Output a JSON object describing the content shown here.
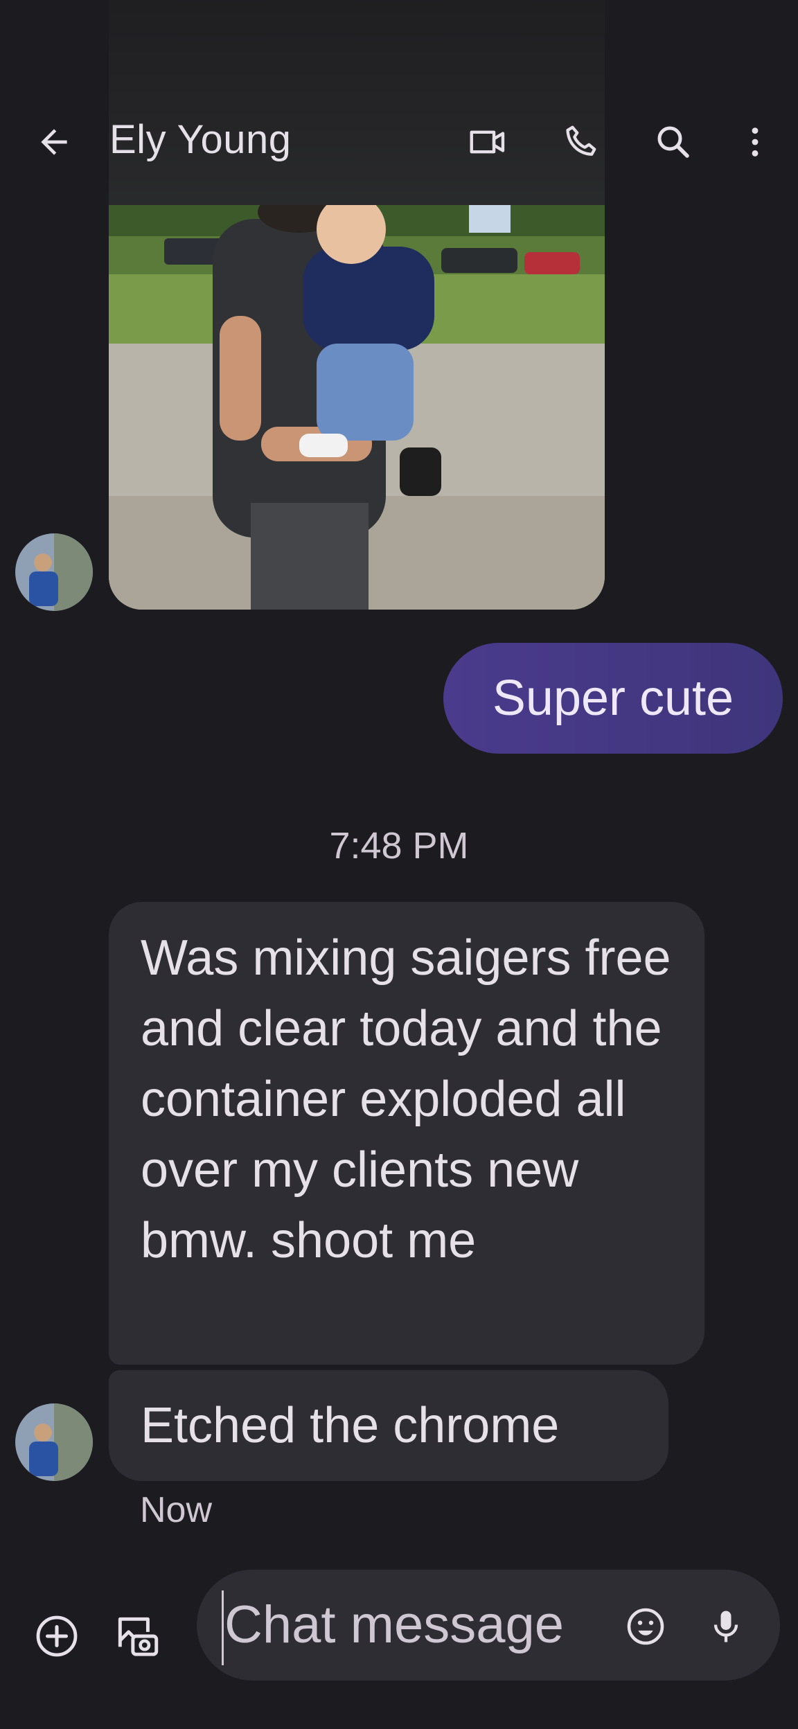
{
  "header": {
    "contact_name": "Ely Young",
    "back_icon": "arrow-left-icon",
    "video_icon": "video-call-icon",
    "phone_icon": "phone-icon",
    "search_icon": "search-icon",
    "more_icon": "more-vert-icon"
  },
  "messages": {
    "outgoing_1": "Super cute",
    "timestamp": "7:48 PM",
    "incoming_1": "Was mixing saigers free and clear today and the container exploded all over my clients new bmw. shoot me",
    "incoming_2": "Etched the chrome",
    "status": "Now"
  },
  "composer": {
    "placeholder": "Chat message",
    "add_icon": "add-circle-icon",
    "gallery_icon": "gallery-camera-icon",
    "emoji_icon": "emoji-icon",
    "mic_icon": "mic-icon"
  },
  "colors": {
    "background": "#1c1b20",
    "incoming_bubble": "#2e2d34",
    "outgoing_bubble": "#4a3b8c",
    "text": "#e6e1e8"
  }
}
